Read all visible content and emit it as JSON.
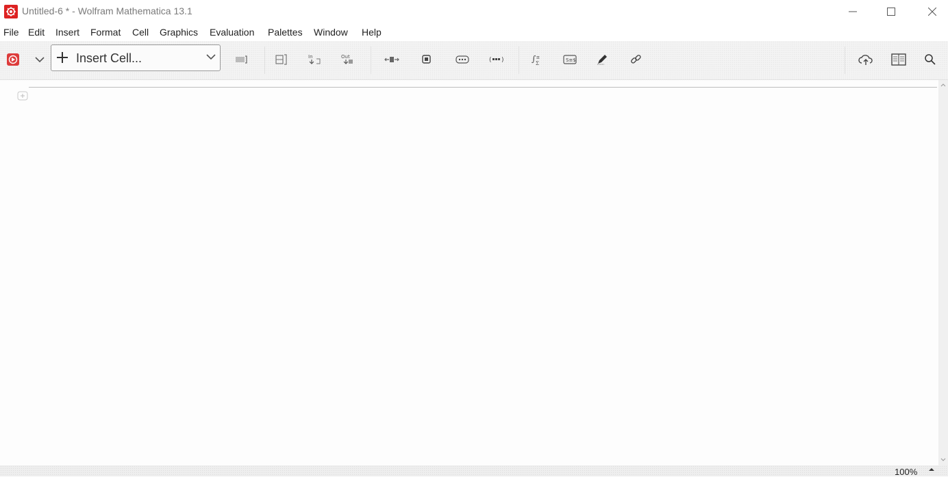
{
  "window": {
    "title": "Untitled-6 * - Wolfram Mathematica 13.1"
  },
  "menu": {
    "items": [
      "File",
      "Edit",
      "Insert",
      "Format",
      "Cell",
      "Graphics",
      "Evaluation",
      "Palettes",
      "Window",
      "Help"
    ]
  },
  "toolbar": {
    "insert_cell_label": "Insert Cell...",
    "icons": [
      "evaluate-icon",
      "dropdown-chevron-icon",
      "toggle-cell-icon",
      "cell-bracket-icon",
      "in-cell-icon",
      "out-cell-icon",
      "resize-icon",
      "frame-icon",
      "more-icon",
      "placeholder-icon",
      "integral-sum-icon",
      "currency-icon",
      "pen-icon",
      "link-icon",
      "cloud-upload-icon",
      "notebook-book-icon",
      "search-icon"
    ]
  },
  "statusbar": {
    "zoom": "100%"
  },
  "colors": {
    "brand": "#dd2222",
    "accent": "#cc3333"
  }
}
